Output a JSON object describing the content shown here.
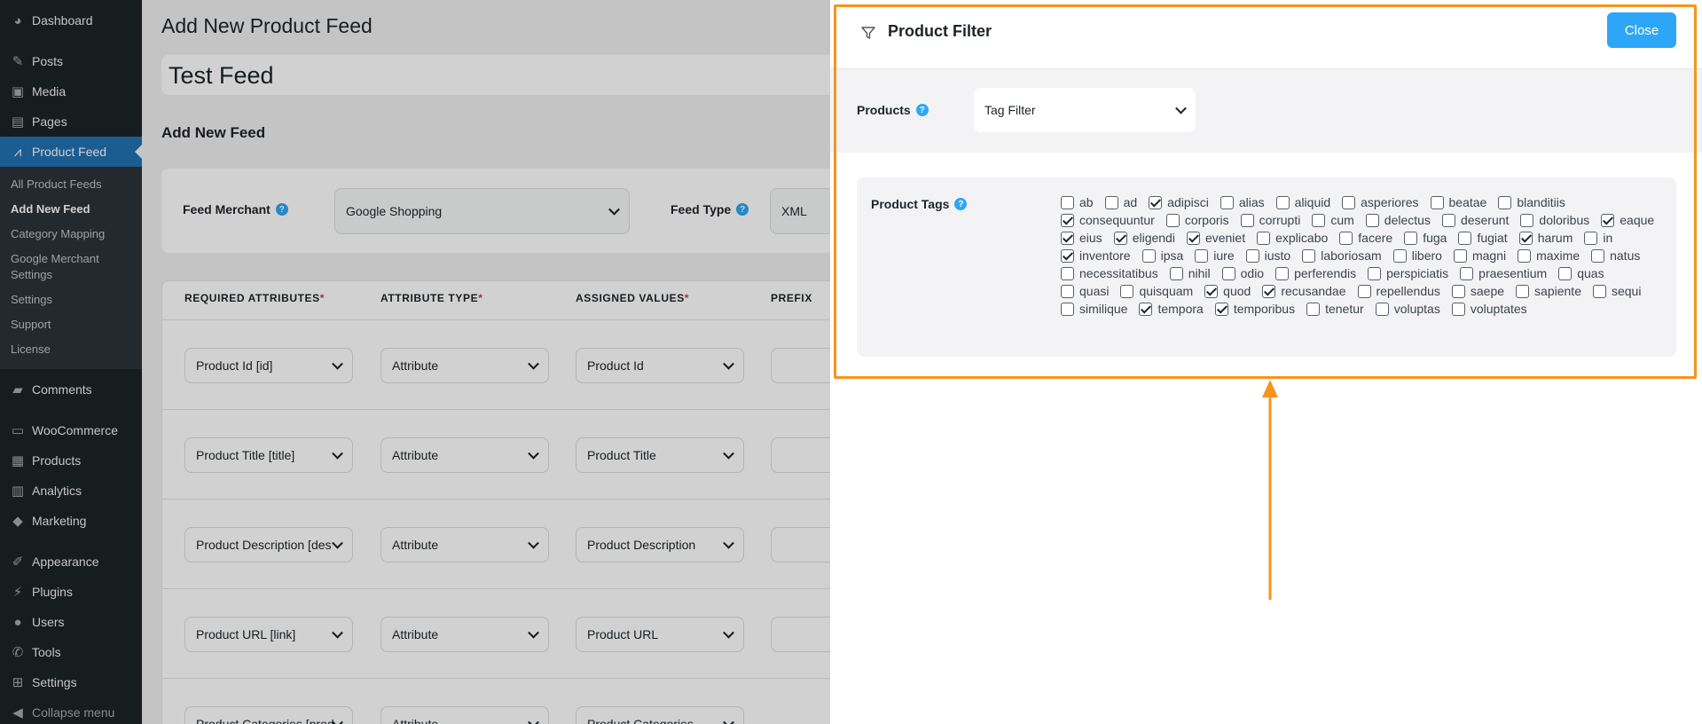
{
  "sidebar": {
    "dashboard": "Dashboard",
    "posts": "Posts",
    "media": "Media",
    "pages": "Pages",
    "product_feed": "Product Feed",
    "submenu": [
      "All Product Feeds",
      "Add New Feed",
      "Category Mapping",
      "Google Merchant Settings",
      "Settings",
      "Support",
      "License"
    ],
    "comments": "Comments",
    "woocommerce": "WooCommerce",
    "products": "Products",
    "analytics": "Analytics",
    "marketing": "Marketing",
    "appearance": "Appearance",
    "plugins": "Plugins",
    "users": "Users",
    "tools": "Tools",
    "settings": "Settings",
    "collapse": "Collapse menu"
  },
  "main": {
    "page_title": "Add New Product Feed",
    "feed_name": "Test Feed",
    "section_title": "Add New Feed",
    "feed_merchant_label": "Feed Merchant",
    "feed_merchant_value": "Google Shopping",
    "feed_type_label": "Feed Type",
    "feed_type_value": "XML",
    "table_headers": {
      "required": "REQUIRED ATTRIBUTES",
      "type": "ATTRIBUTE TYPE",
      "values": "ASSIGNED VALUES",
      "prefix": "PREFIX",
      "asterisk": "*"
    },
    "rows": [
      {
        "attr": "Product Id [id]",
        "type": "Attribute",
        "value": "Product Id"
      },
      {
        "attr": "Product Title [title]",
        "type": "Attribute",
        "value": "Product Title"
      },
      {
        "attr": "Product Description [des",
        "type": "Attribute",
        "value": "Product Description"
      },
      {
        "attr": "Product URL [link]",
        "type": "Attribute",
        "value": "Product URL"
      },
      {
        "attr": "Product Categories [prod",
        "type": "Attribute",
        "value": "Product Categories"
      }
    ]
  },
  "drawer": {
    "title": "Product Filter",
    "close_label": "Close",
    "products_label": "Products",
    "products_value": "Tag Filter",
    "tags_label": "Product Tags",
    "tags": [
      {
        "name": "ab",
        "checked": false
      },
      {
        "name": "ad",
        "checked": false
      },
      {
        "name": "adipisci",
        "checked": true
      },
      {
        "name": "alias",
        "checked": false
      },
      {
        "name": "aliquid",
        "checked": false
      },
      {
        "name": "asperiores",
        "checked": false
      },
      {
        "name": "beatae",
        "checked": false
      },
      {
        "name": "blanditiis",
        "checked": false
      },
      {
        "name": "consequuntur",
        "checked": true
      },
      {
        "name": "corporis",
        "checked": false
      },
      {
        "name": "corrupti",
        "checked": false
      },
      {
        "name": "cum",
        "checked": false
      },
      {
        "name": "delectus",
        "checked": false
      },
      {
        "name": "deserunt",
        "checked": false
      },
      {
        "name": "doloribus",
        "checked": false
      },
      {
        "name": "eaque",
        "checked": true
      },
      {
        "name": "eius",
        "checked": true
      },
      {
        "name": "eligendi",
        "checked": true
      },
      {
        "name": "eveniet",
        "checked": true
      },
      {
        "name": "explicabo",
        "checked": false
      },
      {
        "name": "facere",
        "checked": false
      },
      {
        "name": "fuga",
        "checked": false
      },
      {
        "name": "fugiat",
        "checked": false
      },
      {
        "name": "harum",
        "checked": true
      },
      {
        "name": "in",
        "checked": false
      },
      {
        "name": "inventore",
        "checked": true
      },
      {
        "name": "ipsa",
        "checked": false
      },
      {
        "name": "iure",
        "checked": false
      },
      {
        "name": "iusto",
        "checked": false
      },
      {
        "name": "laboriosam",
        "checked": false
      },
      {
        "name": "libero",
        "checked": false
      },
      {
        "name": "magni",
        "checked": false
      },
      {
        "name": "maxime",
        "checked": false
      },
      {
        "name": "natus",
        "checked": false
      },
      {
        "name": "necessitatibus",
        "checked": false
      },
      {
        "name": "nihil",
        "checked": false
      },
      {
        "name": "odio",
        "checked": false
      },
      {
        "name": "perferendis",
        "checked": false
      },
      {
        "name": "perspiciatis",
        "checked": false
      },
      {
        "name": "praesentium",
        "checked": false
      },
      {
        "name": "quas",
        "checked": false
      },
      {
        "name": "quasi",
        "checked": false
      },
      {
        "name": "quisquam",
        "checked": false
      },
      {
        "name": "quod",
        "checked": true
      },
      {
        "name": "recusandae",
        "checked": true
      },
      {
        "name": "repellendus",
        "checked": false
      },
      {
        "name": "saepe",
        "checked": false
      },
      {
        "name": "sapiente",
        "checked": false
      },
      {
        "name": "sequi",
        "checked": false
      },
      {
        "name": "similique",
        "checked": false
      },
      {
        "name": "tempora",
        "checked": true
      },
      {
        "name": "temporibus",
        "checked": true
      },
      {
        "name": "tenetur",
        "checked": false
      },
      {
        "name": "voluptas",
        "checked": false
      },
      {
        "name": "voluptates",
        "checked": false
      }
    ]
  },
  "colors": {
    "accent": "#2ea6f7",
    "highlight": "#f7941d",
    "sidebar": "#1d2327",
    "active": "#2271b1"
  }
}
